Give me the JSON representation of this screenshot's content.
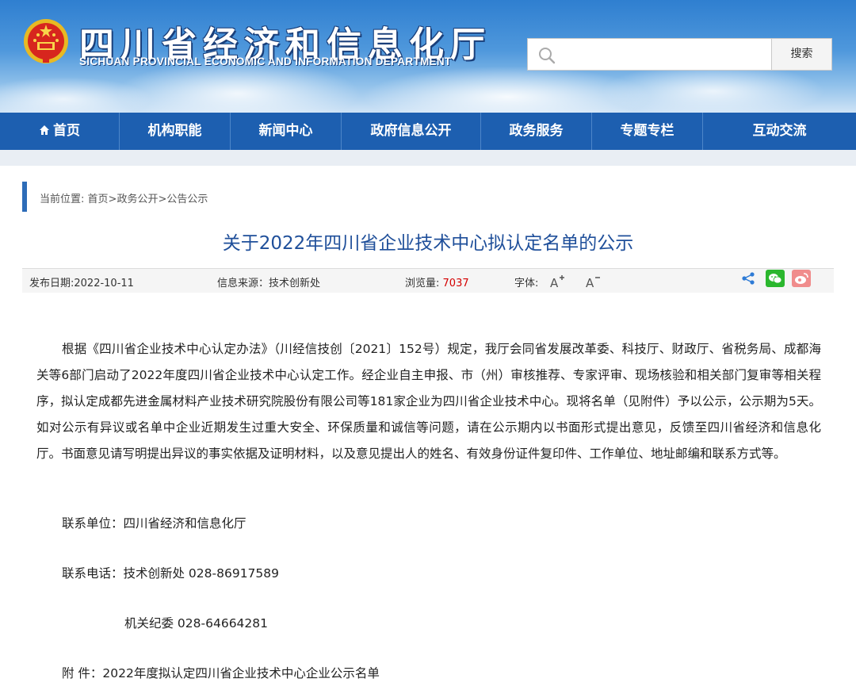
{
  "header": {
    "title": "四川省经济和信息化厅",
    "subtitle": "SICHUAN PROVINCIAL ECONOMIC AND INFORMATION DEPARTMENT",
    "emblem_icon": "national-emblem-icon"
  },
  "search": {
    "placeholder": "",
    "value": "",
    "button_label": "搜索"
  },
  "nav": {
    "items": [
      {
        "label": "首页",
        "icon": "home-icon"
      },
      {
        "label": "机构职能"
      },
      {
        "label": "新闻中心"
      },
      {
        "label": "政府信息公开"
      },
      {
        "label": "政务服务"
      },
      {
        "label": "专题专栏"
      },
      {
        "label": "互动交流"
      }
    ],
    "color": "#1d5fb0"
  },
  "breadcrumb": {
    "prefix": "当前位置:",
    "items": [
      "首页",
      "政务公开",
      "公告公示"
    ],
    "separator": ">"
  },
  "article": {
    "title": "关于2022年四川省企业技术中心拟认定名单的公示",
    "meta": {
      "date_label": "发布日期:",
      "date": "2022-10-11",
      "source_label": "信息来源：",
      "source": "技术创新处",
      "views_label": "浏览量:",
      "views": "7037",
      "font_label": "字体:"
    },
    "body": "根据《四川省企业技术中心认定办法》（川经信技创〔2021〕152号）规定，我厅会同省发展改革委、科技厅、财政厅、省税务局、成都海关等6部门启动了2022年度四川省企业技术中心认定工作。经企业自主申报、市（州）审核推荐、专家评审、现场核验和相关部门复审等相关程序，拟认定成都先进金属材料产业技术研究院股份有限公司等181家企业为四川省企业技术中心。现将名单（见附件）予以公示，公示期为5天。如对公示有异议或名单中企业近期发生过重大安全、环保质量和诚信等问题，请在公示期内以书面形式提出意见，反馈至四川省经济和信息化厅。书面意见请写明提出异议的事实依据及证明材料，以及意见提出人的姓名、有效身份证件复印件、工作单位、地址邮编和联系方式等。",
    "contact_unit": "联系单位：四川省经济和信息化厅",
    "contact_phone": "联系电话：技术创新处  028-86917589",
    "contact_phone2": "机关纪委  028-64664281",
    "attachment": "附  件：2022年度拟认定四川省企业技术中心企业公示名单"
  },
  "share": {
    "icons": [
      "share-icon",
      "wechat-icon",
      "weibo-icon"
    ]
  }
}
